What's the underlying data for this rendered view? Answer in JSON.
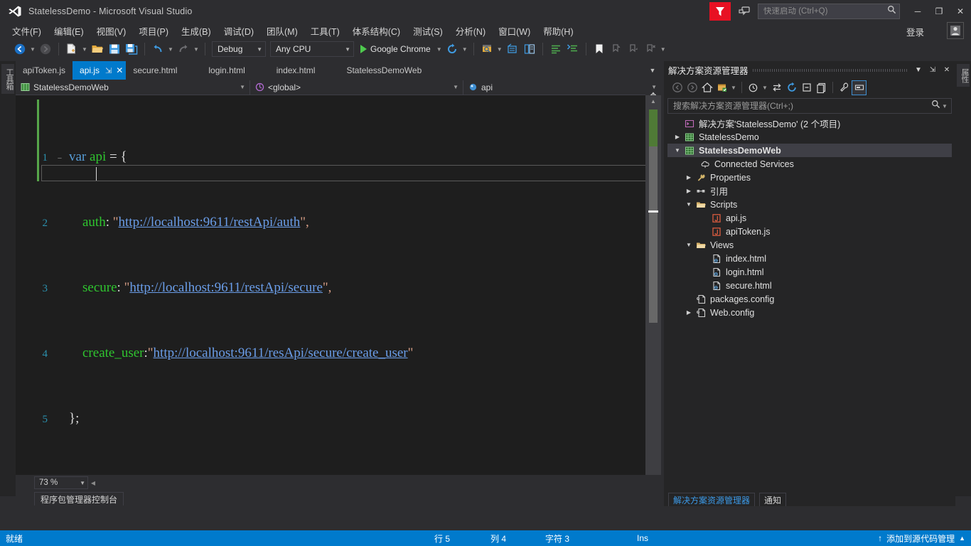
{
  "window": {
    "title": "StatelessDemo - Microsoft Visual Studio",
    "minimize": "─",
    "maximize": "❐",
    "close": "✕",
    "signin": "登录"
  },
  "quick_launch": {
    "placeholder": "快速启动 (Ctrl+Q)",
    "value": ""
  },
  "menu": {
    "items": [
      {
        "label": "文件(F)"
      },
      {
        "label": "编辑(E)"
      },
      {
        "label": "视图(V)"
      },
      {
        "label": "项目(P)"
      },
      {
        "label": "生成(B)"
      },
      {
        "label": "调试(D)"
      },
      {
        "label": "团队(M)"
      },
      {
        "label": "工具(T)"
      },
      {
        "label": "体系结构(C)"
      },
      {
        "label": "测试(S)"
      },
      {
        "label": "分析(N)"
      },
      {
        "label": "窗口(W)"
      },
      {
        "label": "帮助(H)"
      }
    ]
  },
  "toolbar": {
    "configuration": "Debug",
    "platform": "Any CPU",
    "run_target": "Google Chrome"
  },
  "left_dock": {
    "toolbox_label": "工具箱"
  },
  "right_dock": {
    "label": "属性"
  },
  "editor": {
    "tabs": [
      {
        "label": "apiToken.js",
        "active": false
      },
      {
        "label": "api.js",
        "active": true
      },
      {
        "label": "secure.html",
        "active": false
      },
      {
        "label": "login.html",
        "active": false
      },
      {
        "label": "index.html",
        "active": false
      },
      {
        "label": "StatelessDemoWeb",
        "active": false
      }
    ],
    "pin_glyph": "⇲",
    "close_glyph": "✕",
    "nav": {
      "project": "StatelessDemoWeb",
      "scope": "<global>",
      "member": "api"
    },
    "zoom": "73 %",
    "lines": [
      {
        "n": "1",
        "fold": "−",
        "tokens": [
          {
            "t": "var ",
            "c": "k-blue"
          },
          {
            "t": "api",
            "c": "k-green"
          },
          {
            "t": " = {",
            "c": "k-white"
          }
        ]
      },
      {
        "n": "2",
        "fold": "",
        "tokens": [
          {
            "t": "    ",
            "c": "k-white"
          },
          {
            "t": "auth",
            "c": "k-green"
          },
          {
            "t": ": ",
            "c": "k-white"
          },
          {
            "t": "\"",
            "c": "k-str"
          },
          {
            "t": "http://localhost:9611/restApi/auth",
            "c": "k-link"
          },
          {
            "t": "\",",
            "c": "k-str"
          }
        ]
      },
      {
        "n": "3",
        "fold": "",
        "tokens": [
          {
            "t": "    ",
            "c": "k-white"
          },
          {
            "t": "secure",
            "c": "k-green"
          },
          {
            "t": ": ",
            "c": "k-white"
          },
          {
            "t": "\"",
            "c": "k-str"
          },
          {
            "t": "http://localhost:9611/restApi/secure",
            "c": "k-link"
          },
          {
            "t": "\",",
            "c": "k-str"
          }
        ]
      },
      {
        "n": "4",
        "fold": "",
        "tokens": [
          {
            "t": "    ",
            "c": "k-white"
          },
          {
            "t": "create_user",
            "c": "k-green"
          },
          {
            "t": ":",
            "c": "k-white"
          },
          {
            "t": "\"",
            "c": "k-str"
          },
          {
            "t": "http://localhost:9611/resApi/secure/create_user",
            "c": "k-link"
          },
          {
            "t": "\"",
            "c": "k-str"
          }
        ]
      },
      {
        "n": "5",
        "fold": "",
        "tokens": [
          {
            "t": "};",
            "c": "k-white"
          }
        ]
      }
    ]
  },
  "package_manager": {
    "tab_label": "程序包管理器控制台"
  },
  "solution_explorer": {
    "title": "解决方案资源管理器",
    "search_placeholder": "搜索解决方案资源管理器(Ctrl+;)",
    "search_value": "",
    "tree": [
      {
        "label": "解决方案'StatelessDemo' (2 个项目)",
        "indent": 0,
        "twisty": "",
        "icon": "solution-icon",
        "selected": false,
        "bold": false
      },
      {
        "label": "StatelessDemo",
        "indent": 1,
        "twisty": "▶",
        "icon": "project-icon",
        "selected": false,
        "bold": false
      },
      {
        "label": "StatelessDemoWeb",
        "indent": 1,
        "twisty": "▼",
        "icon": "project-icon",
        "selected": true,
        "bold": true
      },
      {
        "label": "Connected Services",
        "indent": 2,
        "twisty": "",
        "icon": "cloud-icon",
        "selected": false,
        "bold": false
      },
      {
        "label": "Properties",
        "indent": 2,
        "twisty": "▶",
        "icon": "wrench-icon",
        "selected": false,
        "bold": false
      },
      {
        "label": "引用",
        "indent": 2,
        "twisty": "▶",
        "icon": "references-icon",
        "selected": false,
        "bold": false
      },
      {
        "label": "Scripts",
        "indent": 2,
        "twisty": "▼",
        "icon": "folder-icon",
        "selected": false,
        "bold": false
      },
      {
        "label": "api.js",
        "indent": 3,
        "twisty": "",
        "icon": "js-file-icon",
        "selected": false,
        "bold": false
      },
      {
        "label": "apiToken.js",
        "indent": 3,
        "twisty": "",
        "icon": "js-file-icon",
        "selected": false,
        "bold": false
      },
      {
        "label": "Views",
        "indent": 2,
        "twisty": "▼",
        "icon": "folder-icon",
        "selected": false,
        "bold": false
      },
      {
        "label": "index.html",
        "indent": 3,
        "twisty": "",
        "icon": "html-file-icon",
        "selected": false,
        "bold": false
      },
      {
        "label": "login.html",
        "indent": 3,
        "twisty": "",
        "icon": "html-file-icon",
        "selected": false,
        "bold": false
      },
      {
        "label": "secure.html",
        "indent": 3,
        "twisty": "",
        "icon": "html-file-icon",
        "selected": false,
        "bold": false
      },
      {
        "label": "packages.config",
        "indent": 2,
        "twisty": "",
        "icon": "config-file-icon",
        "selected": false,
        "bold": false
      },
      {
        "label": "Web.config",
        "indent": 2,
        "twisty": "▶",
        "icon": "config-file-icon",
        "selected": false,
        "bold": false
      }
    ],
    "footer_tabs": [
      {
        "label": "解决方案资源管理器",
        "active": true
      },
      {
        "label": "通知",
        "active": false
      }
    ]
  },
  "status_bar": {
    "ready": "就绪",
    "line": "行 5",
    "column": "列 4",
    "character": "字符 3",
    "insert_mode": "Ins",
    "source_control": "添加到源代码管理",
    "up_arrow": "↑",
    "up_caret": "▲"
  },
  "colors": {
    "accent": "#007acc",
    "chrome": "#2d2d30",
    "editor_bg": "#1e1e1e",
    "panel_bg": "#252526",
    "alert": "#e81123"
  }
}
